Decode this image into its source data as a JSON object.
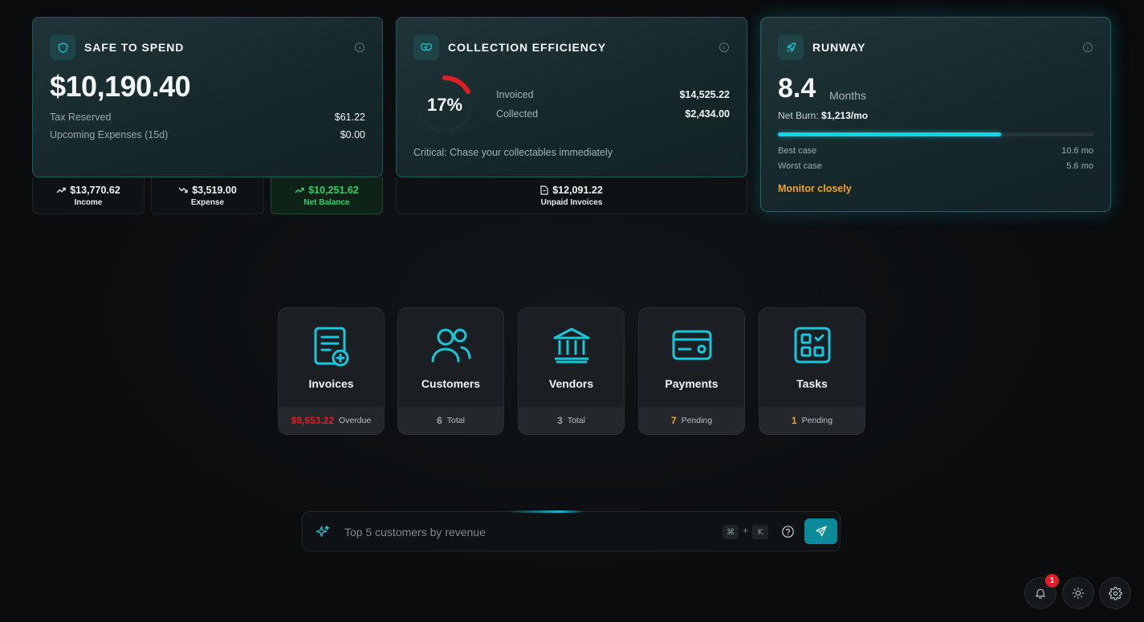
{
  "colors": {
    "accent": "#13d2ea",
    "positive": "#2fcf6b",
    "warning": "#f0a424",
    "danger": "#e11d25",
    "critical_arc": "#e11d25"
  },
  "safe_to_spend": {
    "title": "SAFE TO SPEND",
    "icon": "shield-icon",
    "amount": "$10,190.40",
    "tax_reserved_label": "Tax Reserved",
    "tax_reserved_value": "$61.22",
    "upcoming_label": "Upcoming Expenses (15d)",
    "upcoming_value": "$0.00",
    "income": {
      "amount": "$13,770.62",
      "label": "Income"
    },
    "expense": {
      "amount": "$3,519.00",
      "label": "Expense"
    },
    "net_balance": {
      "amount": "$10,251.62",
      "label": "Net Balance"
    }
  },
  "collection_efficiency": {
    "title": "COLLECTION EFFICIENCY",
    "icon": "handshake-icon",
    "percent_text": "17%",
    "percent": 17,
    "invoiced_label": "Invoiced",
    "invoiced_value": "$14,525.22",
    "collected_label": "Collected",
    "collected_value": "$2,434.00",
    "message": "Critical: Chase your collectables immediately",
    "unpaid": {
      "amount": "$12,091.22",
      "label": "Unpaid Invoices"
    }
  },
  "runway": {
    "title": "RUNWAY",
    "icon": "rocket-icon",
    "value": "8.4",
    "unit": "Months",
    "net_burn_label": "Net Burn:",
    "net_burn_value": "$1,213/mo",
    "progress": 0.705,
    "best_label": "Best case",
    "best_value": "10.6 mo",
    "worst_label": "Worst case",
    "worst_value": "5.6 mo",
    "status": "Monitor closely"
  },
  "tiles": [
    {
      "name": "Invoices",
      "icon": "invoice-icon",
      "num": "$9,653.22",
      "num_color": "#e11d25",
      "suffix": "Overdue"
    },
    {
      "name": "Customers",
      "icon": "users-icon",
      "num": "6",
      "num_color": "#9aa4a8",
      "suffix": "Total"
    },
    {
      "name": "Vendors",
      "icon": "bank-icon",
      "num": "3",
      "num_color": "#9aa4a8",
      "suffix": "Total"
    },
    {
      "name": "Payments",
      "icon": "credit-card-icon",
      "num": "7",
      "num_color": "#f0a424",
      "suffix": "Pending"
    },
    {
      "name": "Tasks",
      "icon": "tasks-grid-icon",
      "num": "1",
      "num_color": "#f0a424",
      "suffix": "Pending"
    }
  ],
  "search": {
    "placeholder": "Top 5 customers by revenue",
    "shortcut_cmd": "⌘",
    "shortcut_plus": "+",
    "shortcut_key": "K"
  },
  "notifications": {
    "count": "1"
  }
}
